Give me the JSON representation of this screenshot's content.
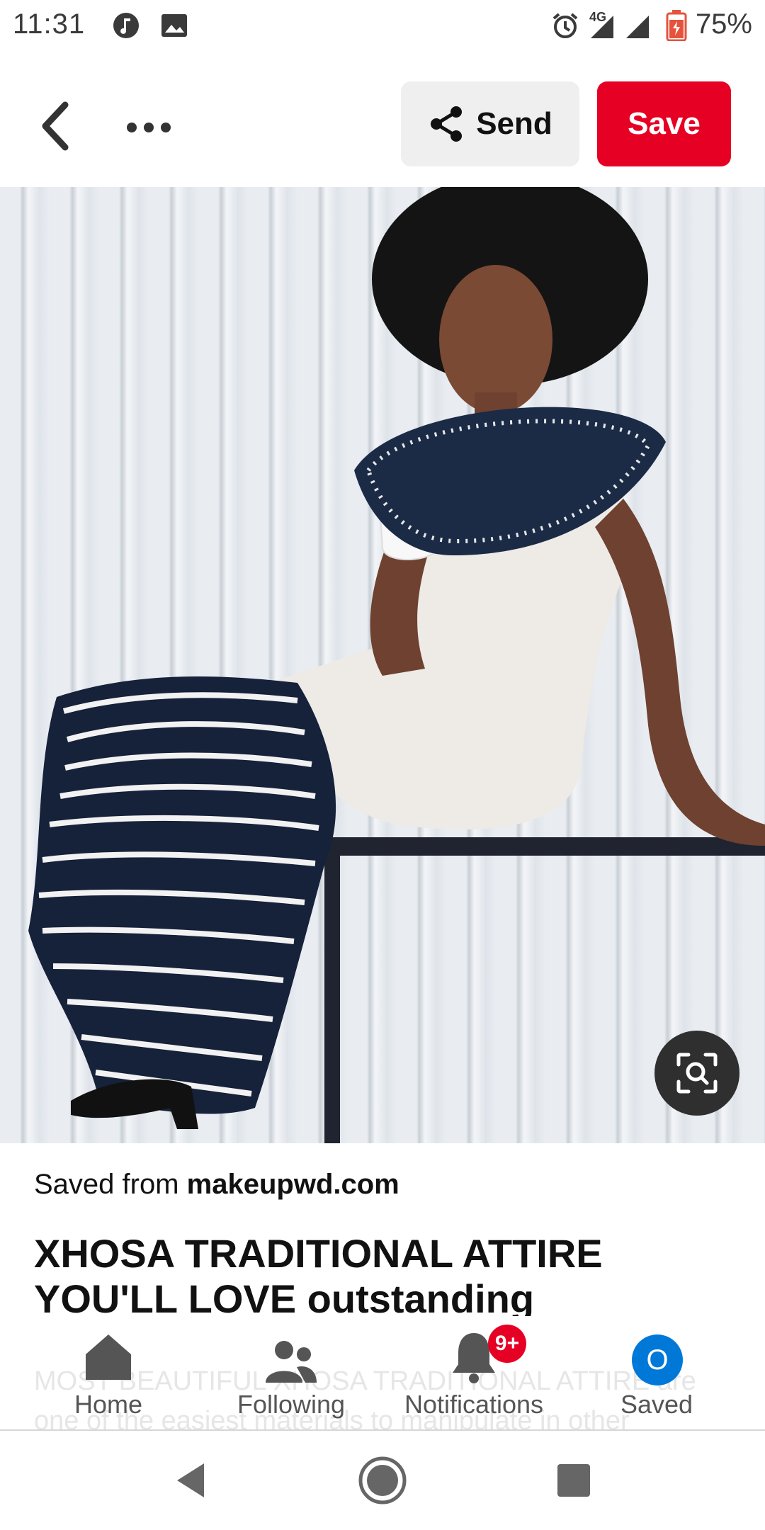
{
  "status": {
    "time": "11:31",
    "network": "4G",
    "battery": "75%"
  },
  "toolbar": {
    "send_label": "Send",
    "save_label": "Save",
    "accent_color": "#e60023"
  },
  "pin": {
    "saved_from_prefix": "Saved from",
    "source": "makeupwd.com",
    "title": "XHOSA TRADITIONAL ATTIRE YOU'LL LOVE outstanding",
    "description": "MOST BEAUTIFUL XHOSA TRADITIONAL ATTIRE are one of the easiest materials to manipulate in other"
  },
  "bottom_nav": {
    "items": [
      {
        "label": "Home",
        "icon": "home-icon"
      },
      {
        "label": "Following",
        "icon": "following-icon"
      },
      {
        "label": "Notifications",
        "icon": "bell-icon",
        "badge": "9+"
      },
      {
        "label": "Saved",
        "icon": "avatar",
        "avatar_letter": "O"
      }
    ]
  }
}
